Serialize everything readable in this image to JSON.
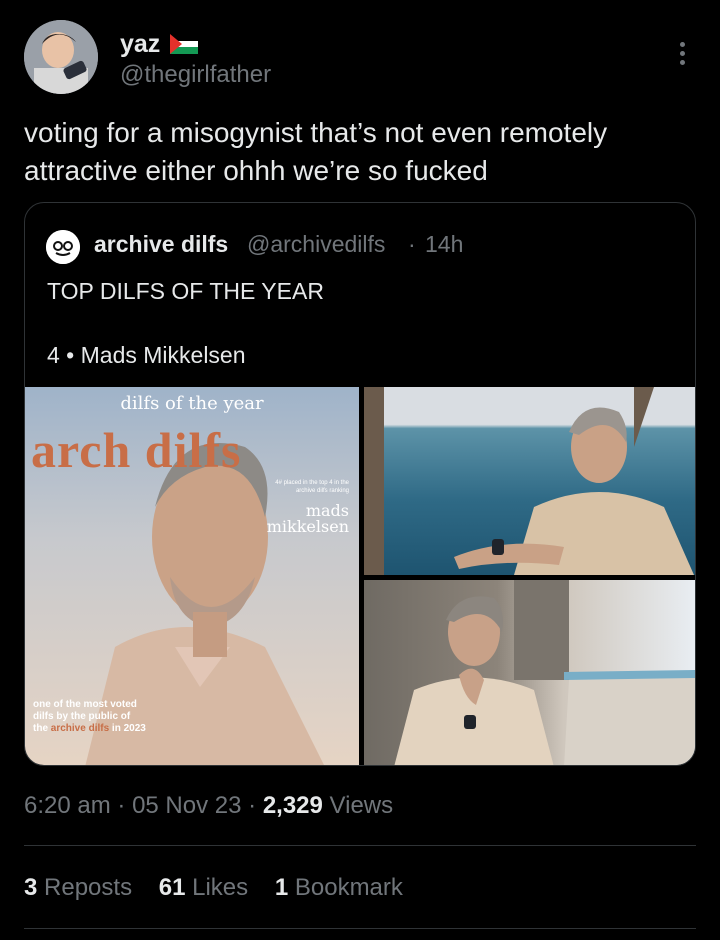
{
  "author": {
    "display_name": "yaz",
    "handle": "@thegirlfather",
    "flag_icon": "palestine-flag-icon",
    "more_icon": "more-dots-icon"
  },
  "tweet": {
    "text": "voting for a misogynist that’s not even remotely\nattractive either ohhh we’re so fucked"
  },
  "quote": {
    "display_name": "archive dilfs",
    "handle": "@archivedilfs",
    "separator": "·",
    "time": "14h",
    "line1": "TOP DILFS OF THE YEAR",
    "line2": "4 • Mads Mikkelsen",
    "cover": {
      "top_text": "dilfs of the year",
      "brand_text": "arch   dilfs",
      "small_text": "4# placed in the top 4 in the archive dilfs ranking",
      "name_line1": "mads",
      "name_line2": "mikkelsen",
      "bottom_line1": "one of the most voted",
      "bottom_line2": "dilfs by the public of",
      "bottom_the": "the",
      "bottom_accent": "archive dilfs",
      "bottom_year": "in 2023"
    }
  },
  "meta": {
    "time": "6:20 am",
    "dot": "·",
    "date": "05 Nov 23",
    "views_count": "2,329",
    "views_label": "Views"
  },
  "stats": {
    "reposts_count": "3",
    "reposts_label": "Reposts",
    "likes_count": "61",
    "likes_label": "Likes",
    "bookmarks_count": "1",
    "bookmarks_label": "Bookmark"
  },
  "colors": {
    "background": "#000000",
    "text": "#e7e9ea",
    "muted": "#71767b",
    "border": "#2f3336",
    "cover_accent": "#c86e47"
  }
}
